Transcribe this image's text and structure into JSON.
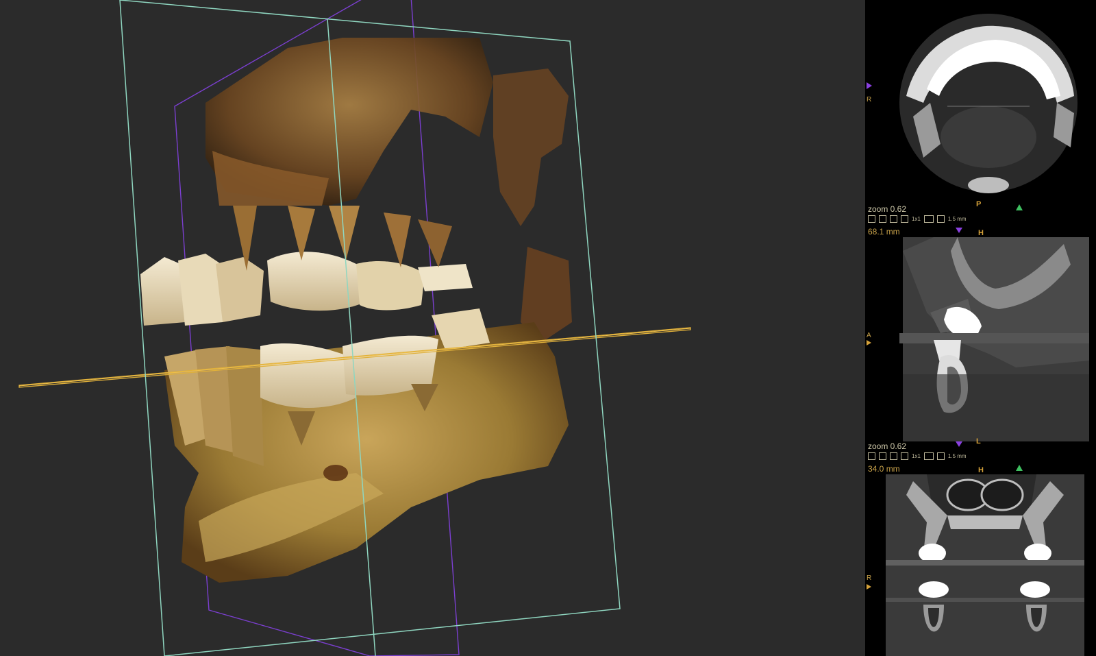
{
  "colors": {
    "viewport_bg": "#2b2b2b",
    "bone": "#b8954a",
    "tooth": "#ece0c4",
    "coronal_plane": "#8fd6c0",
    "sagittal_plane": "#7b3fd0",
    "axial_plane": "#e0b03a",
    "marker_purple": "#8a40e0",
    "marker_green": "#3ec060",
    "marker_orange": "#d6a23a"
  },
  "axial_view": {
    "left_marker": "R"
  },
  "sagittal_view": {
    "zoom": "zoom 0.62",
    "distance": "68.1 mm",
    "top_label": "P",
    "top_label_right": "H",
    "left_marker": "A",
    "tool_text_1": "1x1",
    "tool_text_2": "1.5 mm"
  },
  "coronal_view": {
    "zoom": "zoom 0.62",
    "distance": "34.0 mm",
    "top_label": "L",
    "top_label_right": "H",
    "left_marker": "R",
    "tool_text_1": "1x1",
    "tool_text_2": "1.5 mm"
  }
}
